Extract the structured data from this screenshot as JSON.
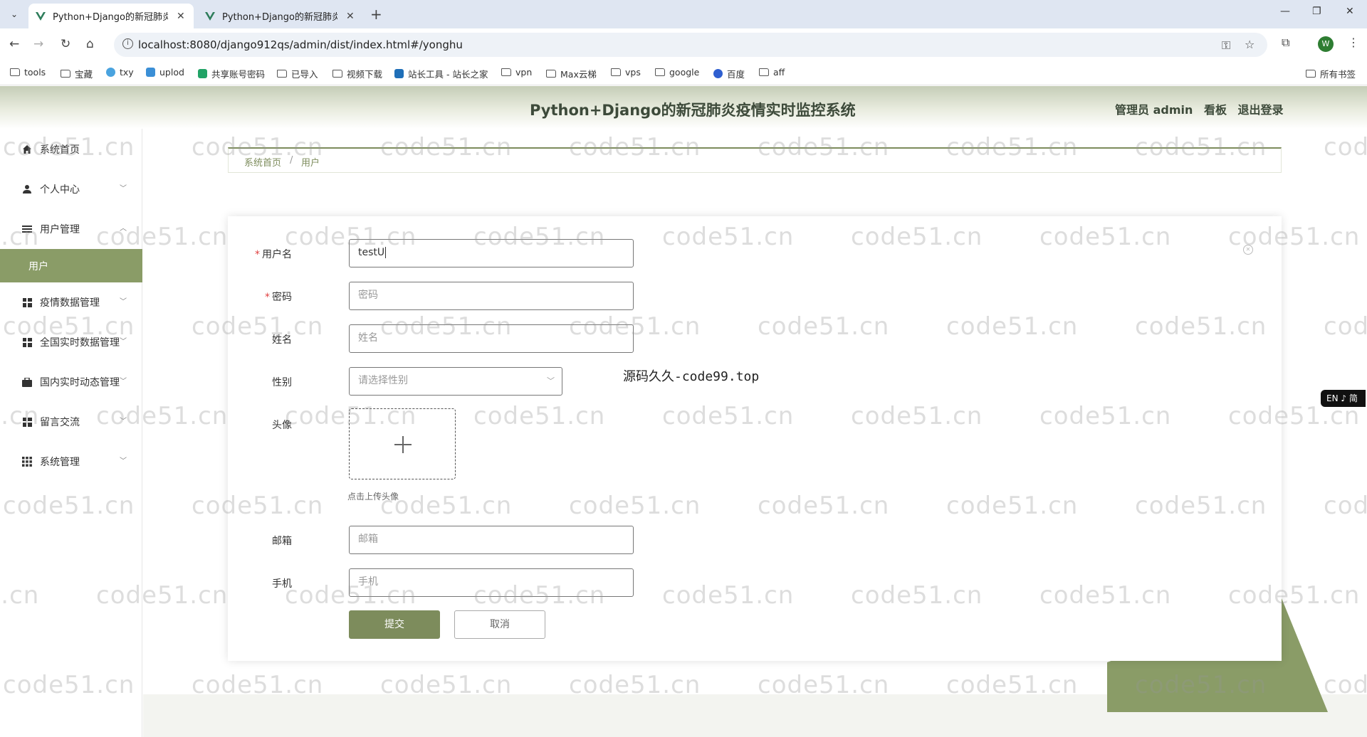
{
  "browser": {
    "tabs": [
      {
        "title": "Python+Django的新冠肺炎疫情",
        "active": true
      },
      {
        "title": "Python+Django的新冠肺炎疫情",
        "active": false
      }
    ],
    "url": "localhost:8080/django912qs/admin/dist/index.html#/yonghu",
    "profile_initial": "W",
    "bookmarks": [
      "tools",
      "宝藏",
      "txy",
      "uplod",
      "共享账号密码",
      "已导入",
      "视频下载",
      "站长工具 - 站长之家",
      "vpn",
      "Max云梯",
      "vps",
      "google",
      "百度",
      "aff"
    ],
    "all_bookmarks_label": "所有书签"
  },
  "header": {
    "title": "Python+Django的新冠肺炎疫情实时监控系统",
    "admin_label": "管理员 admin",
    "board_link": "看板",
    "logout_link": "退出登录"
  },
  "sidebar": {
    "items": [
      {
        "label": "系统首页",
        "icon": "home-icon"
      },
      {
        "label": "个人中心",
        "icon": "user-icon"
      },
      {
        "label": "用户管理",
        "icon": "list-icon"
      },
      {
        "label": "用户",
        "icon": ""
      },
      {
        "label": "疫情数据管理",
        "icon": "grid-icon"
      },
      {
        "label": "全国实时数据管理",
        "icon": "grid-icon"
      },
      {
        "label": "国内实时动态管理",
        "icon": "briefcase-icon"
      },
      {
        "label": "留言交流",
        "icon": "grid-icon"
      },
      {
        "label": "系统管理",
        "icon": "apps-icon"
      }
    ]
  },
  "breadcrumb": {
    "home": "系统首页",
    "separator": "/",
    "current": "用户"
  },
  "form": {
    "username": {
      "label": "用户名",
      "value": "testU"
    },
    "password": {
      "label": "密码",
      "placeholder": "密码"
    },
    "name": {
      "label": "姓名",
      "placeholder": "姓名"
    },
    "gender": {
      "label": "性别",
      "placeholder": "请选择性别"
    },
    "avatar": {
      "label": "头像",
      "tip": "点击上传头像"
    },
    "email": {
      "label": "邮箱",
      "placeholder": "邮箱"
    },
    "phone": {
      "label": "手机",
      "placeholder": "手机"
    },
    "submit_label": "提交",
    "cancel_label": "取消"
  },
  "overlay_text": "源码久久-code99.top",
  "lang_badge": "EN ♪ 简",
  "watermark": "code51.cn",
  "colors": {
    "accent": "#7d8c5c",
    "header_gradient": "#c5cdb7",
    "required": "#e04040"
  }
}
